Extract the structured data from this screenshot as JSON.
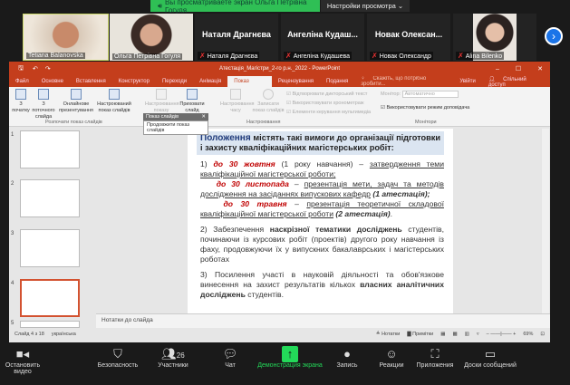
{
  "zoom_banner": {
    "text": "Вы просматриваете экран Ольга Петрівна Гогуля",
    "view_options": "Настройки просмотра"
  },
  "participants": [
    {
      "name": "Tetiana Balanovska",
      "big": ""
    },
    {
      "name": "Ольга Петрівна Гогуля",
      "big": ""
    },
    {
      "name": "Наталя Драгнєва",
      "big": "Наталя Драгнєва"
    },
    {
      "name": "Ангеліна Кудашева",
      "big": "Ангеліна Кудаш..."
    },
    {
      "name": "Новак Олександр",
      "big": "Новак Олексан..."
    },
    {
      "name": "Alina Bilenko",
      "big": ""
    }
  ],
  "ppt": {
    "title": "Атестація_Магістри_2-го р.н._2022 - PowerPoint",
    "tabs": [
      "Файл",
      "Основне",
      "Вставлення",
      "Конструктор",
      "Переходи",
      "Анімація",
      "Показ слайдів",
      "Рецензування",
      "Подання"
    ],
    "tell_me": "Скажіть, що потрібно зробити...",
    "signin": "Увійти",
    "share": "Спільний доступ",
    "ribbon": {
      "from_start": "З початку",
      "from_current": "З поточного слайда",
      "online": "Онлайнове презентування",
      "custom": "Настроюваний показ слайдів",
      "group1": "Розпочати показ слайдів",
      "setup": "Настроювання показу слайдів",
      "hide": "Приховати слайд",
      "rehearse": "Настроювання часу",
      "record": "Записати показ слайдів",
      "cb1": "Відтворювати дикторський текст",
      "cb2": "Використовувати хронометраж",
      "cb3": "Елементи керування мультимедіа",
      "group2": "Настроювання",
      "monitor_label": "Монітор:",
      "monitor_value": "Автоматично",
      "presenter": "Використовувати режим доповідача",
      "group3": "Монітори"
    },
    "popup": {
      "title": "Показ слайдів",
      "item": "Продовжити показ слайдів"
    },
    "slide": {
      "h_bold": "Положення",
      "h_rest": " містять такі вимоги до організації підготовки і захисту кваліфікаційних магістерських робіт:",
      "i1a": "1) ",
      "i1b": "до 30 жовтня",
      "i1c": " (1 року навчання) – ",
      "i1d": "затвердження теми кваліфікаційної магістерської роботи;",
      "i2b": "до 30 листопада",
      "i2c": " – ",
      "i2d": "презентація мети, задач та методів дослідження на засіданнях випускових кафедр",
      "i2e": " (1 атестація);",
      "i3b": "до 30 травня",
      "i3c": " – ",
      "i3d": "презентація теоретичної складової кваліфікаційної магістерської роботи",
      "i3e": " (2 атестація)",
      "p2a": "2) Забезпечення ",
      "p2b": "наскрізної тематики досліджень",
      "p2c": " студентів, починаючи із курсових робіт (проектів) другого року навчання із фаху, продовжуючи їх у випускних бакалаврських і магістерських роботах",
      "p3a": "3) Посилення участі в науковій діяльності та обов'язкове винесення на захист результатів кількох ",
      "p3b": "власних аналітичних досліджень",
      "p3c": " студентів."
    },
    "thumb_numbers": [
      "1",
      "2",
      "3",
      "4",
      "5"
    ],
    "notes": "Нотатки до слайда",
    "status": {
      "slide": "Слайд 4 з 18",
      "lang": "українська",
      "notes": "Нотатки",
      "comments": "Примітки",
      "zoom": "69%"
    }
  },
  "toolbar": {
    "video": "Остановить видео",
    "security": "Безопасность",
    "participants": "Участники",
    "count": "26",
    "chat": "Чат",
    "share": "Демонстрация экрана",
    "record": "Запись",
    "reactions": "Реакции",
    "apps": "Приложения",
    "whiteboards": "Доски сообщений"
  }
}
